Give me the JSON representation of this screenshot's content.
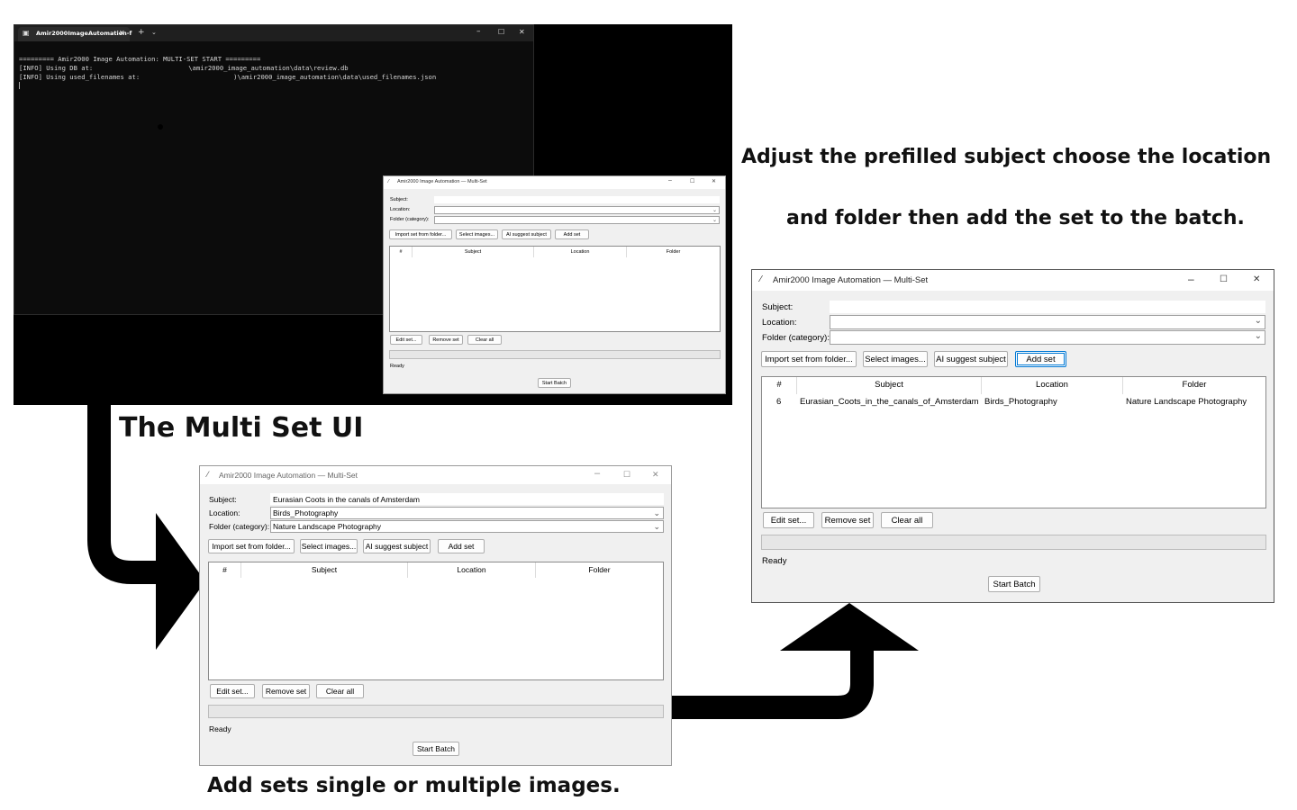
{
  "terminal": {
    "tab_title": "Amir2000ImageAutomation-f",
    "line1": "========= Amir2000 Image Automation: MULTI-SET START =========",
    "line2_prefix": "[INFO] Using DB at:",
    "line2_suffix": "\\amir2000_image_automation\\data\\review.db",
    "line3_prefix": "[INFO] Using used_filenames at:",
    "line3_suffix": ")\\amir2000_image_automation\\data\\used_filenames.json"
  },
  "app": {
    "title": "Amir2000 Image Automation — Multi-Set",
    "subject_label": "Subject:",
    "location_label": "Location:",
    "folder_label": "Folder (category):",
    "import_btn": "Import set from folder...",
    "select_btn": "Select images...",
    "ai_btn": "AI suggest subject",
    "add_btn": "Add set",
    "col_num": "#",
    "col_subject": "Subject",
    "col_location": "Location",
    "col_folder": "Folder",
    "edit_btn": "Edit set...",
    "remove_btn": "Remove set",
    "clear_btn": "Clear all",
    "status": "Ready",
    "start_btn": "Start Batch"
  },
  "window_filled": {
    "subject_value": "Eurasian Coots in the canals of Amsterdam",
    "location_value": "Birds_Photography",
    "folder_value": "Nature Landscape Photography"
  },
  "window_added": {
    "row": {
      "num": "6",
      "subject": "Eurasian_Coots_in_the_canals_of_Amsterdam",
      "location": "Birds_Photography",
      "folder": "Nature Landscape Photography"
    }
  },
  "captions": {
    "multi_set": "The Multi Set UI",
    "add_sets": "Add sets single or multiple images.",
    "adjust_line1": "Adjust the prefilled subject choose the location",
    "adjust_line2": "and folder then add the set to the batch."
  }
}
